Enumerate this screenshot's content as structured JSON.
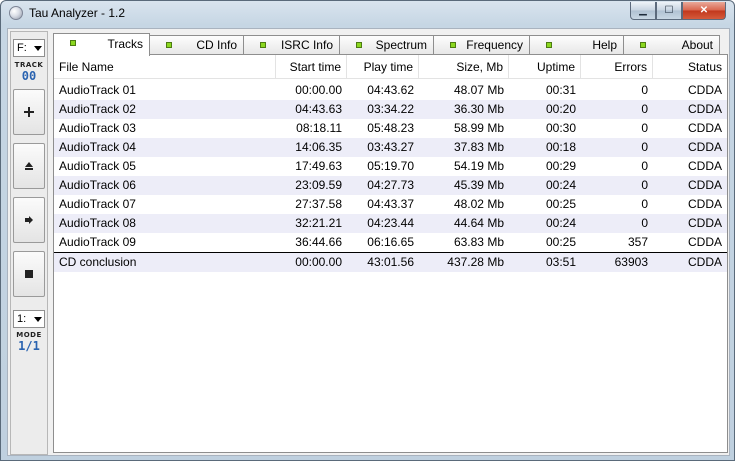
{
  "window": {
    "title": "Tau Analyzer - 1.2",
    "close_glyph": "✕",
    "min_glyph": "▁",
    "max_glyph": "☐"
  },
  "toolbar": {
    "drive_value": "F:",
    "track_caption": "TRACK",
    "track_number": "00",
    "mode_value": "1:",
    "mode_caption": "MODE",
    "mode_value_display": "1/1",
    "buttons": [
      {
        "name": "plus-icon"
      },
      {
        "name": "eject-icon"
      },
      {
        "name": "play-icon"
      },
      {
        "name": "stop-icon"
      }
    ]
  },
  "tabs": [
    {
      "label": "Tracks",
      "active": true
    },
    {
      "label": "CD Info",
      "active": false
    },
    {
      "label": "ISRC Info",
      "active": false
    },
    {
      "label": "Spectrum",
      "active": false
    },
    {
      "label": "Frequency",
      "active": false
    },
    {
      "label": "Help",
      "active": false
    },
    {
      "label": "About",
      "active": false
    }
  ],
  "table": {
    "columns": [
      "File Name",
      "Start time",
      "Play time",
      "Size, Mb",
      "Uptime",
      "Errors",
      "Status"
    ],
    "rows": [
      [
        "AudioTrack 01",
        "00:00.00",
        "04:43.62",
        "48.07 Mb",
        "00:31",
        "0",
        "CDDA"
      ],
      [
        "AudioTrack 02",
        "04:43.63",
        "03:34.22",
        "36.30 Mb",
        "00:20",
        "0",
        "CDDA"
      ],
      [
        "AudioTrack 03",
        "08:18.11",
        "05:48.23",
        "58.99 Mb",
        "00:30",
        "0",
        "CDDA"
      ],
      [
        "AudioTrack 04",
        "14:06.35",
        "03:43.27",
        "37.83 Mb",
        "00:18",
        "0",
        "CDDA"
      ],
      [
        "AudioTrack 05",
        "17:49.63",
        "05:19.70",
        "54.19 Mb",
        "00:29",
        "0",
        "CDDA"
      ],
      [
        "AudioTrack 06",
        "23:09.59",
        "04:27.73",
        "45.39 Mb",
        "00:24",
        "0",
        "CDDA"
      ],
      [
        "AudioTrack 07",
        "27:37.58",
        "04:43.37",
        "48.02 Mb",
        "00:25",
        "0",
        "CDDA"
      ],
      [
        "AudioTrack 08",
        "32:21.21",
        "04:23.44",
        "44.64 Mb",
        "00:24",
        "0",
        "CDDA"
      ],
      [
        "AudioTrack 09",
        "36:44.66",
        "06:16.65",
        "63.83 Mb",
        "00:25",
        "357",
        "CDDA"
      ]
    ],
    "conclusion": [
      "CD conclusion",
      "00:00.00",
      "43:01.56",
      "437.28 Mb",
      "03:51",
      "63903",
      "CDDA"
    ]
  },
  "colors": {
    "led": "#8bd81f",
    "alt_row": "#ededf8",
    "counter": "#2a63b0"
  }
}
